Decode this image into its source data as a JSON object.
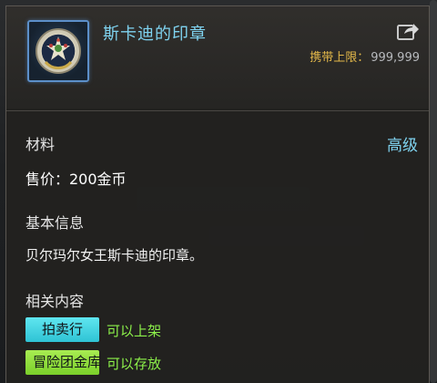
{
  "item": {
    "name": "斯卡迪的印章",
    "icon": "seal-medallion-icon"
  },
  "carry_limit": {
    "label": "携带上限：",
    "value": "999,999"
  },
  "properties": {
    "type": "材料",
    "grade": "高级",
    "price": "售价：200金币"
  },
  "basic_info": {
    "title": "基本信息",
    "description": "贝尔玛尔女王斯卡迪的印章。"
  },
  "related": {
    "title": "相关内容",
    "auction_tag": "拍卖行",
    "auction_note": "可以上架",
    "guild_tag": "冒险团金库",
    "guild_note": "可以存放"
  },
  "colors": {
    "name": "#7fd3f0",
    "limit_label": "#e3b84a",
    "grade": "#7fd3f0",
    "auction_tag_bg": "#3fd2e0",
    "guild_tag_bg": "#8fdc38",
    "note": "#8cf04a"
  }
}
